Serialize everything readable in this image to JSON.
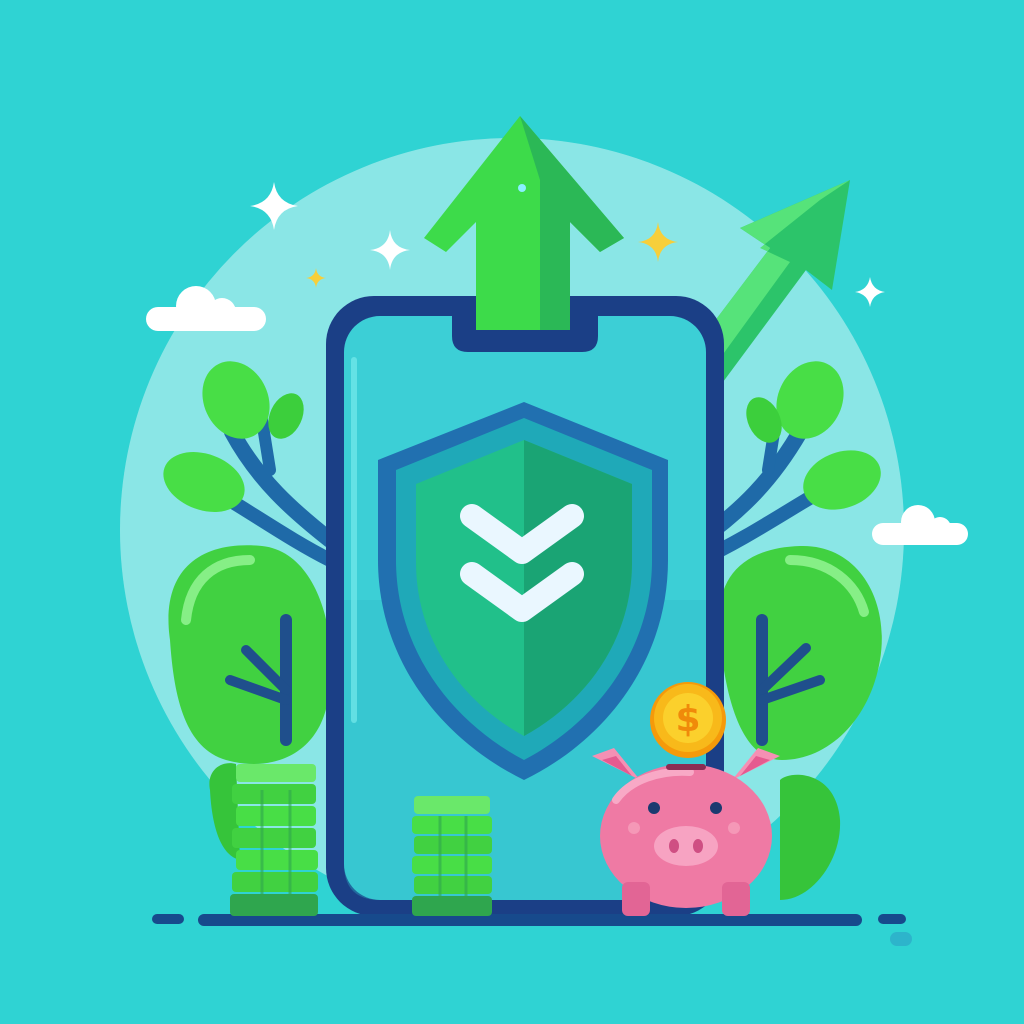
{
  "illustration": {
    "coin": {
      "symbol": "$"
    }
  },
  "colors": {
    "background": "#2fd3d3",
    "halo": "#a8ecec",
    "phone_frame": "#1b3f86",
    "phone_screen": "#3ccfd6",
    "shield_green": "#21c08a",
    "leaf_green": "#48de46",
    "arrow_green": "#3ddb4a",
    "piggy_pink": "#ef7aa4",
    "coin_gold": "#f8b91a",
    "ground": "#174a8c"
  },
  "icons": [
    "upward-arrow-icon",
    "growth-arrow-icon",
    "phone-icon",
    "shield-icon",
    "double-chevron-down-icon",
    "piggy-bank-icon",
    "dollar-coin-icon",
    "coin-stack-icon",
    "tree-icon",
    "cloud-icon",
    "sparkle-icon"
  ]
}
